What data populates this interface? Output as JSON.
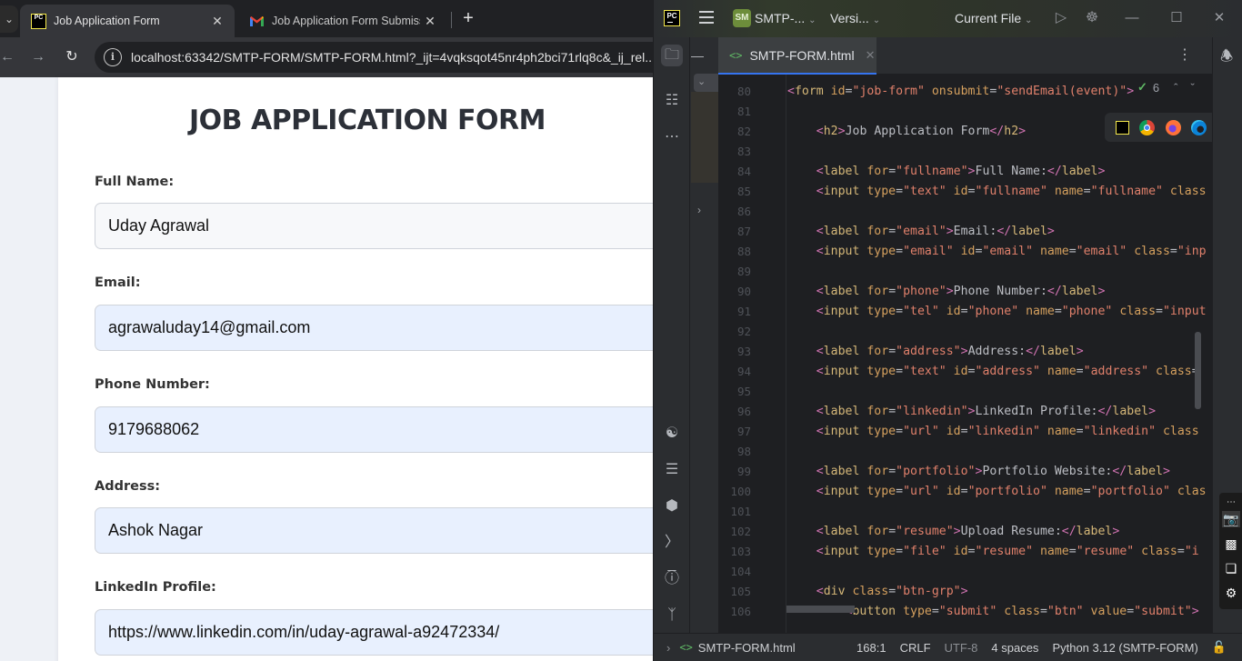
{
  "browser": {
    "tabs": [
      {
        "title": "Job Application Form",
        "favicon": "pycharm-icon",
        "active": true
      },
      {
        "title": "Job Application Form Submissio",
        "favicon": "gmail-icon",
        "active": false
      }
    ],
    "address_bar": {
      "url": "localhost:63342/SMTP-FORM/SMTP-FORM.html?_ijt=4vqksqot45nr4ph2bci71rlq8c&_ij_rel..."
    }
  },
  "page": {
    "title": "JOB APPLICATION FORM",
    "fields": [
      {
        "label": "Full Name:",
        "value": "Uday Agrawal"
      },
      {
        "label": "Email:",
        "value": "agrawaluday14@gmail.com"
      },
      {
        "label": "Phone Number:",
        "value": "9179688062"
      },
      {
        "label": "Address:",
        "value": "Ashok Nagar"
      },
      {
        "label": "LinkedIn Profile:",
        "value": "https://www.linkedin.com/in/uday-agrawal-a92472334/"
      }
    ]
  },
  "ide": {
    "project_badge": "SM",
    "project_name": "SMTP-...",
    "vcs_menu": "Versi...",
    "run_config": "Current File",
    "open_file_tab": "SMTP-FORM.html",
    "inspection_count": "6",
    "code_lines": [
      {
        "n": "80",
        "indent": 0,
        "segs": [
          [
            "br",
            "<"
          ],
          [
            "tag",
            "form"
          ],
          [
            "attr",
            " id"
          ],
          [
            "txt",
            "="
          ],
          [
            "val",
            "\"job-form\""
          ],
          [
            "attr",
            " onsubmit"
          ],
          [
            "txt",
            "="
          ],
          [
            "val",
            "\"sendEmail(event)\""
          ],
          [
            "br",
            ">"
          ]
        ]
      },
      {
        "n": "81",
        "indent": 0,
        "segs": []
      },
      {
        "n": "82",
        "indent": 4,
        "segs": [
          [
            "br",
            "<"
          ],
          [
            "tag",
            "h2"
          ],
          [
            "br",
            ">"
          ],
          [
            "txt",
            "Job Application Form"
          ],
          [
            "br",
            "</"
          ],
          [
            "tag",
            "h2"
          ],
          [
            "br",
            ">"
          ]
        ]
      },
      {
        "n": "83",
        "indent": 0,
        "segs": []
      },
      {
        "n": "84",
        "indent": 4,
        "segs": [
          [
            "br",
            "<"
          ],
          [
            "tag",
            "label"
          ],
          [
            "attr",
            " for"
          ],
          [
            "txt",
            "="
          ],
          [
            "val",
            "\"fullname\""
          ],
          [
            "br",
            ">"
          ],
          [
            "txt",
            "Full Name:"
          ],
          [
            "br",
            "</"
          ],
          [
            "tag",
            "label"
          ],
          [
            "br",
            ">"
          ]
        ]
      },
      {
        "n": "85",
        "indent": 4,
        "segs": [
          [
            "br",
            "<"
          ],
          [
            "tag",
            "input"
          ],
          [
            "attr",
            " type"
          ],
          [
            "txt",
            "="
          ],
          [
            "val",
            "\"text\""
          ],
          [
            "attr",
            " id"
          ],
          [
            "txt",
            "="
          ],
          [
            "val",
            "\"fullname\""
          ],
          [
            "attr",
            " name"
          ],
          [
            "txt",
            "="
          ],
          [
            "val",
            "\"fullname\""
          ],
          [
            "attr",
            " class"
          ]
        ]
      },
      {
        "n": "86",
        "indent": 0,
        "segs": []
      },
      {
        "n": "87",
        "indent": 4,
        "segs": [
          [
            "br",
            "<"
          ],
          [
            "tag",
            "label"
          ],
          [
            "attr",
            " for"
          ],
          [
            "txt",
            "="
          ],
          [
            "val",
            "\"email\""
          ],
          [
            "br",
            ">"
          ],
          [
            "txt",
            "Email:"
          ],
          [
            "br",
            "</"
          ],
          [
            "tag",
            "label"
          ],
          [
            "br",
            ">"
          ]
        ]
      },
      {
        "n": "88",
        "indent": 4,
        "segs": [
          [
            "br",
            "<"
          ],
          [
            "tag",
            "input"
          ],
          [
            "attr",
            " type"
          ],
          [
            "txt",
            "="
          ],
          [
            "val",
            "\"email\""
          ],
          [
            "attr",
            " id"
          ],
          [
            "txt",
            "="
          ],
          [
            "val",
            "\"email\""
          ],
          [
            "attr",
            " name"
          ],
          [
            "txt",
            "="
          ],
          [
            "val",
            "\"email\""
          ],
          [
            "attr",
            " class"
          ],
          [
            "txt",
            "="
          ],
          [
            "val",
            "\"inp"
          ]
        ]
      },
      {
        "n": "89",
        "indent": 0,
        "segs": []
      },
      {
        "n": "90",
        "indent": 4,
        "segs": [
          [
            "br",
            "<"
          ],
          [
            "tag",
            "label"
          ],
          [
            "attr",
            " for"
          ],
          [
            "txt",
            "="
          ],
          [
            "val",
            "\"phone\""
          ],
          [
            "br",
            ">"
          ],
          [
            "txt",
            "Phone Number:"
          ],
          [
            "br",
            "</"
          ],
          [
            "tag",
            "label"
          ],
          [
            "br",
            ">"
          ]
        ]
      },
      {
        "n": "91",
        "indent": 4,
        "segs": [
          [
            "br",
            "<"
          ],
          [
            "tag",
            "input"
          ],
          [
            "attr",
            " type"
          ],
          [
            "txt",
            "="
          ],
          [
            "val",
            "\"tel\""
          ],
          [
            "attr",
            " id"
          ],
          [
            "txt",
            "="
          ],
          [
            "val",
            "\"phone\""
          ],
          [
            "attr",
            " name"
          ],
          [
            "txt",
            "="
          ],
          [
            "val",
            "\"phone\""
          ],
          [
            "attr",
            " class"
          ],
          [
            "txt",
            "="
          ],
          [
            "val",
            "\"input"
          ]
        ]
      },
      {
        "n": "92",
        "indent": 0,
        "segs": []
      },
      {
        "n": "93",
        "indent": 4,
        "segs": [
          [
            "br",
            "<"
          ],
          [
            "tag",
            "label"
          ],
          [
            "attr",
            " for"
          ],
          [
            "txt",
            "="
          ],
          [
            "val",
            "\"address\""
          ],
          [
            "br",
            ">"
          ],
          [
            "txt",
            "Address:"
          ],
          [
            "br",
            "</"
          ],
          [
            "tag",
            "label"
          ],
          [
            "br",
            ">"
          ]
        ]
      },
      {
        "n": "94",
        "indent": 4,
        "segs": [
          [
            "br",
            "<"
          ],
          [
            "tag",
            "input"
          ],
          [
            "attr",
            " type"
          ],
          [
            "txt",
            "="
          ],
          [
            "val",
            "\"text\""
          ],
          [
            "attr",
            " id"
          ],
          [
            "txt",
            "="
          ],
          [
            "val",
            "\"address\""
          ],
          [
            "attr",
            " name"
          ],
          [
            "txt",
            "="
          ],
          [
            "val",
            "\"address\""
          ],
          [
            "attr",
            " class"
          ],
          [
            "txt",
            "="
          ]
        ]
      },
      {
        "n": "95",
        "indent": 0,
        "segs": []
      },
      {
        "n": "96",
        "indent": 4,
        "segs": [
          [
            "br",
            "<"
          ],
          [
            "tag",
            "label"
          ],
          [
            "attr",
            " for"
          ],
          [
            "txt",
            "="
          ],
          [
            "val",
            "\"linkedin\""
          ],
          [
            "br",
            ">"
          ],
          [
            "txt",
            "LinkedIn Profile:"
          ],
          [
            "br",
            "</"
          ],
          [
            "tag",
            "label"
          ],
          [
            "br",
            ">"
          ]
        ]
      },
      {
        "n": "97",
        "indent": 4,
        "segs": [
          [
            "br",
            "<"
          ],
          [
            "tag",
            "input"
          ],
          [
            "attr",
            " type"
          ],
          [
            "txt",
            "="
          ],
          [
            "val",
            "\"url\""
          ],
          [
            "attr",
            " id"
          ],
          [
            "txt",
            "="
          ],
          [
            "val",
            "\"linkedin\""
          ],
          [
            "attr",
            " name"
          ],
          [
            "txt",
            "="
          ],
          [
            "val",
            "\"linkedin\""
          ],
          [
            "attr",
            " class"
          ]
        ]
      },
      {
        "n": "98",
        "indent": 0,
        "segs": []
      },
      {
        "n": "99",
        "indent": 4,
        "segs": [
          [
            "br",
            "<"
          ],
          [
            "tag",
            "label"
          ],
          [
            "attr",
            " for"
          ],
          [
            "txt",
            "="
          ],
          [
            "val",
            "\"portfolio\""
          ],
          [
            "br",
            ">"
          ],
          [
            "txt",
            "Portfolio Website:"
          ],
          [
            "br",
            "</"
          ],
          [
            "tag",
            "label"
          ],
          [
            "br",
            ">"
          ]
        ]
      },
      {
        "n": "100",
        "indent": 4,
        "segs": [
          [
            "br",
            "<"
          ],
          [
            "tag",
            "input"
          ],
          [
            "attr",
            " type"
          ],
          [
            "txt",
            "="
          ],
          [
            "val",
            "\"url\""
          ],
          [
            "attr",
            " id"
          ],
          [
            "txt",
            "="
          ],
          [
            "val",
            "\"portfolio\""
          ],
          [
            "attr",
            " name"
          ],
          [
            "txt",
            "="
          ],
          [
            "val",
            "\"portfolio\""
          ],
          [
            "attr",
            " clas"
          ]
        ]
      },
      {
        "n": "101",
        "indent": 0,
        "segs": []
      },
      {
        "n": "102",
        "indent": 4,
        "segs": [
          [
            "br",
            "<"
          ],
          [
            "tag",
            "label"
          ],
          [
            "attr",
            " for"
          ],
          [
            "txt",
            "="
          ],
          [
            "val",
            "\"resume\""
          ],
          [
            "br",
            ">"
          ],
          [
            "txt",
            "Upload Resume:"
          ],
          [
            "br",
            "</"
          ],
          [
            "tag",
            "label"
          ],
          [
            "br",
            ">"
          ]
        ]
      },
      {
        "n": "103",
        "indent": 4,
        "segs": [
          [
            "br",
            "<"
          ],
          [
            "tag",
            "input"
          ],
          [
            "attr",
            " type"
          ],
          [
            "txt",
            "="
          ],
          [
            "val",
            "\"file\""
          ],
          [
            "attr",
            " id"
          ],
          [
            "txt",
            "="
          ],
          [
            "val",
            "\"resume\""
          ],
          [
            "attr",
            " name"
          ],
          [
            "txt",
            "="
          ],
          [
            "val",
            "\"resume\""
          ],
          [
            "attr",
            " class"
          ],
          [
            "txt",
            "="
          ],
          [
            "val",
            "\"i"
          ]
        ]
      },
      {
        "n": "104",
        "indent": 0,
        "segs": []
      },
      {
        "n": "105",
        "indent": 4,
        "segs": [
          [
            "br",
            "<"
          ],
          [
            "tag",
            "div"
          ],
          [
            "attr",
            " class"
          ],
          [
            "txt",
            "="
          ],
          [
            "val",
            "\"btn-grp\""
          ],
          [
            "br",
            ">"
          ]
        ]
      },
      {
        "n": "106",
        "indent": 8,
        "segs": [
          [
            "br",
            "<"
          ],
          [
            "tag",
            "button"
          ],
          [
            "attr",
            " type"
          ],
          [
            "txt",
            "="
          ],
          [
            "val",
            "\"submit\""
          ],
          [
            "attr",
            " class"
          ],
          [
            "txt",
            "="
          ],
          [
            "val",
            "\"btn\""
          ],
          [
            "attr",
            " value"
          ],
          [
            "txt",
            "="
          ],
          [
            "val",
            "\"submit\""
          ],
          [
            "br",
            ">"
          ]
        ]
      }
    ],
    "status_bar": {
      "breadcrumb": "SMTP-FORM.html",
      "position": "168:1",
      "line_separator": "CRLF",
      "encoding": "UTF-8",
      "indent": "4 spaces",
      "interpreter": "Python 3.12 (SMTP-FORM)"
    }
  }
}
